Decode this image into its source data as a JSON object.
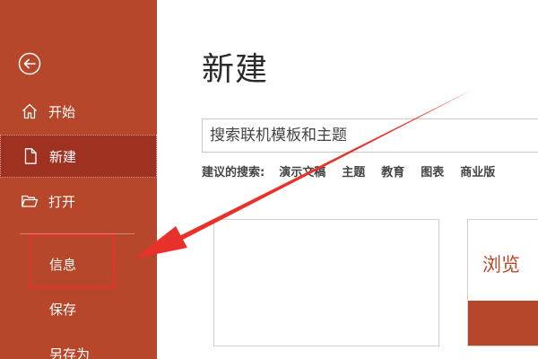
{
  "sidebar": {
    "back_icon": "back-arrow-icon",
    "items": [
      {
        "label": "开始",
        "icon": "home-icon"
      },
      {
        "label": "新建",
        "icon": "new-document-icon"
      },
      {
        "label": "打开",
        "icon": "folder-open-icon"
      },
      {
        "label": "信息"
      },
      {
        "label": "保存"
      },
      {
        "label": "另存为"
      }
    ],
    "active_index": 1,
    "highlighted_index": 3
  },
  "main": {
    "title": "新建",
    "search": {
      "placeholder": "搜索联机模板和主题"
    },
    "suggested": {
      "label": "建议的搜索:",
      "links": [
        "演示文稿",
        "主题",
        "教育",
        "图表",
        "商业版"
      ]
    },
    "templates": [
      {
        "name": ""
      },
      {
        "name": "浏览"
      }
    ]
  },
  "colors": {
    "accent": "#b7472a",
    "active_item": "#9e3120",
    "annotation": "#e8312a"
  }
}
